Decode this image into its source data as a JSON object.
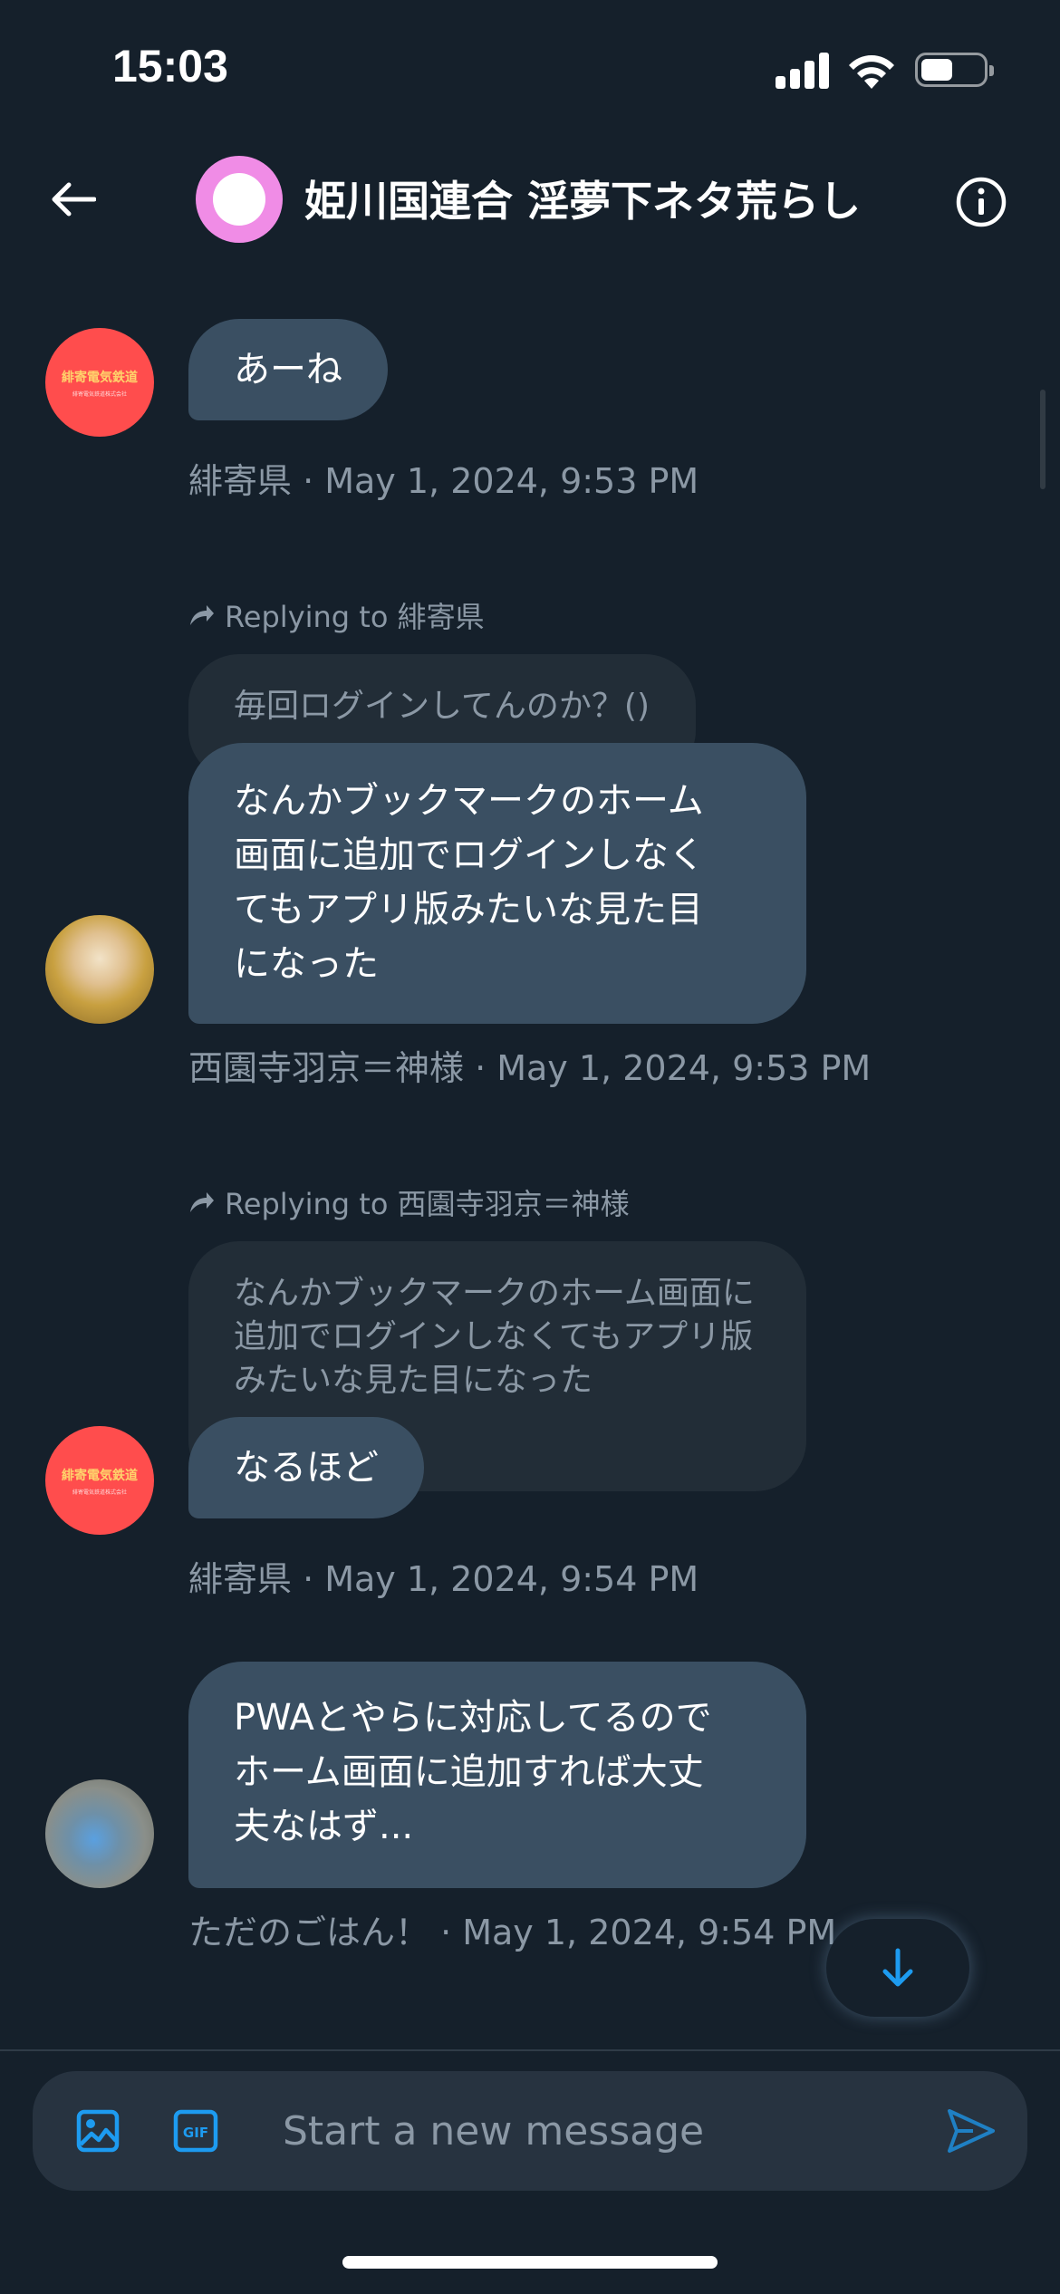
{
  "status_bar": {
    "time": "15:03"
  },
  "header": {
    "title": "姫川国連合 淫夢下ネタ荒らし"
  },
  "avatars": {
    "red_avatar_text": "緋寄電気鉄道",
    "red_avatar_sub": "緋寄電気鉄道株式会社"
  },
  "messages": [
    {
      "text": "あーね",
      "meta": "緋寄県 · May 1, 2024, 9:53 PM"
    },
    {
      "replying_to": "Replying to 緋寄県",
      "quoted": "毎回ログインしてんのか？()",
      "lines": [
        "なんかブックマークのホーム",
        "画面に追加でログインしなく",
        "てもアプリ版みたいな見た目",
        "になった"
      ],
      "meta": "西園寺羽京＝神様 · May 1, 2024, 9:53 PM"
    },
    {
      "replying_to": "Replying to 西園寺羽京＝神様",
      "quoted_lines": [
        "なんかブックマークのホーム画面に",
        "追加でログインしなくてもアプリ版",
        "みたいな見た目になった"
      ],
      "text": "なるほど",
      "meta": "緋寄県 · May 1, 2024, 9:54 PM"
    },
    {
      "lines": [
        "PWAとやらに対応してるので",
        "ホーム画面に追加すれば大丈",
        "夫なはず..."
      ],
      "meta": "ただのごはん！ · May 1, 2024, 9:54 PM"
    }
  ],
  "composer": {
    "placeholder": "Start a new message",
    "gif_label": "GIF"
  },
  "colors": {
    "accent": "#1d9bf0",
    "bubble": "#3a4f62",
    "background": "#15202b"
  }
}
